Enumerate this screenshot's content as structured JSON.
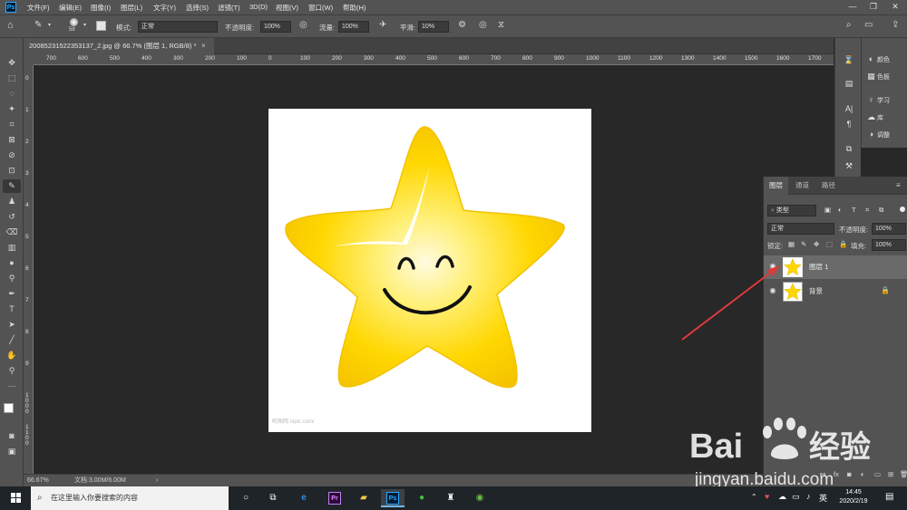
{
  "app": {
    "logo": "Ps"
  },
  "menu": [
    "文件(F)",
    "编辑(E)",
    "图像(I)",
    "图层(L)",
    "文字(Y)",
    "选择(S)",
    "滤镜(T)",
    "3D(D)",
    "视图(V)",
    "窗口(W)",
    "帮助(H)"
  ],
  "window_controls": [
    "—",
    "❐",
    "✕"
  ],
  "options": {
    "brush_size": "58",
    "mode_label": "模式:",
    "mode_value": "正常",
    "opacity_label": "不透明度:",
    "opacity_value": "100%",
    "flow_label": "流量:",
    "flow_value": "100%",
    "smooth_label": "平滑:",
    "smooth_value": "10%"
  },
  "document": {
    "tab_title": "20085231522353137_2.jpg @ 66.7% (图层 1, RGB/8) *",
    "close": "×",
    "watermark": "昵图网 nipic.com/"
  },
  "ruler_top": [
    "700",
    "600",
    "500",
    "400",
    "300",
    "200",
    "100",
    "0",
    "100",
    "200",
    "300",
    "400",
    "500",
    "600",
    "700",
    "800",
    "900",
    "1000",
    "1100",
    "1200",
    "1300",
    "1400",
    "1500",
    "1600",
    "1700"
  ],
  "ruler_left": [
    "0",
    "1",
    "2",
    "3",
    "4",
    "5",
    "6",
    "7",
    "8",
    "9",
    "1 0 0 0",
    "1 1 0 0"
  ],
  "status": {
    "zoom": "66.67%",
    "doc": "文档:3.00M/6.00M",
    "arrow": "›"
  },
  "dock_panels": [
    {
      "icon": "palette-icon",
      "label": "颜色"
    },
    {
      "icon": "swatches-icon",
      "label": "色板"
    },
    {
      "icon": "learn-icon",
      "label": "学习"
    },
    {
      "icon": "library-icon",
      "label": "库"
    },
    {
      "icon": "adjustments-icon",
      "label": "调整"
    }
  ],
  "layers_panel": {
    "tabs": [
      "图层",
      "通道",
      "路径"
    ],
    "filter_label": "类型",
    "blend_mode": "正常",
    "opacity_label": "不透明度:",
    "opacity_value": "100%",
    "lock_label": "锁定:",
    "fill_label": "填充:",
    "fill_value": "100%",
    "layers": [
      {
        "name": "图层 1",
        "selected": true,
        "locked": false
      },
      {
        "name": "背景",
        "selected": false,
        "locked": true
      }
    ]
  },
  "taskbar": {
    "search_placeholder": "在这里输入你要搜索的内容",
    "time": "14:45",
    "date": "2020/2/19",
    "ime": "英"
  },
  "baidu": {
    "brand": "Bai",
    "jingyan": "经验",
    "url": "jingyan.baidu.com"
  },
  "colors": {
    "accent": "#31a8ff",
    "panel": "#535353",
    "canvas_bg": "#282828",
    "star": "#ffd700",
    "arrow": "#e03a3a"
  }
}
